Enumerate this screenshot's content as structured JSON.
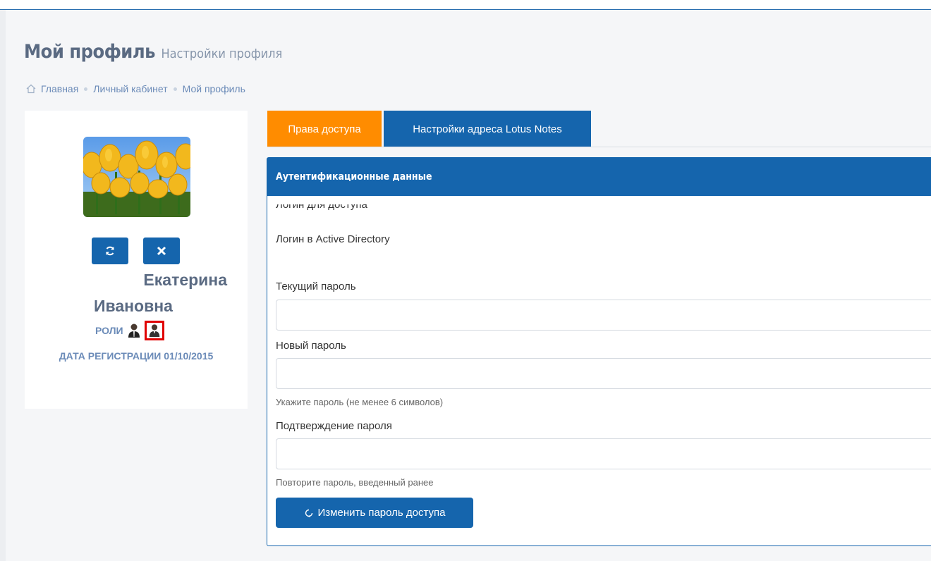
{
  "header": {
    "title": "Мой профиль",
    "subtitle": "Настройки профиля"
  },
  "breadcrumb": {
    "items": [
      "Главная",
      "Личный кабинет",
      "Мой профиль"
    ]
  },
  "profile": {
    "first_line": "Екатерина",
    "second_line": "Ивановна",
    "roles_label": "РОЛИ",
    "registration": "ДАТА РЕГИСТРАЦИИ 01/10/2015",
    "icons": {
      "refresh": "refresh-icon",
      "remove": "close-icon",
      "role_1": "user-icon",
      "role_2": "user-icon"
    },
    "selected_role_outline_color": "#e00000"
  },
  "tabs": [
    {
      "label": "Права доступа",
      "color": "#ff8c00"
    },
    {
      "label": "Настройки адреса Lotus Notes",
      "color": "#1565ad"
    }
  ],
  "panel": {
    "title": "Аутентификационные данные",
    "clipped_label": "Логин для доступа",
    "login_label": "Логин в Active Directory",
    "current_password_label": "Текущий пароль",
    "new_password_label": "Новый пароль",
    "new_password_hint": "Укажите пароль (не менее 6 символов)",
    "confirm_password_label": "Подтверждение пароля",
    "confirm_password_hint": "Повторите пароль, введенный ранее",
    "submit_label": "Изменить пароль доступа",
    "current_password_value": "",
    "new_password_value": "",
    "confirm_password_value": ""
  },
  "colors": {
    "accent": "#1565ad",
    "tab_active": "#ff8c00"
  }
}
